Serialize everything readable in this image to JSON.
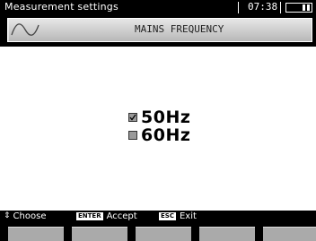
{
  "titlebar": {
    "title": "Measurement settings",
    "time": "07:38",
    "battery_icon": "battery-icon"
  },
  "header": {
    "wave_icon": "sine-wave-icon",
    "heading": "MAINS FREQUENCY"
  },
  "options": [
    {
      "label": "50Hz",
      "checked": true
    },
    {
      "label": "60Hz",
      "checked": false
    }
  ],
  "hints": {
    "choose": "Choose",
    "enter_key": "ENTER",
    "accept": "Accept",
    "esc_key": "ESC",
    "exit": "Exit"
  },
  "colors": {
    "bar": "#000000",
    "background": "#ffffff",
    "fkey": "#aaaaaa",
    "header_panel": "#cfcfcf"
  }
}
